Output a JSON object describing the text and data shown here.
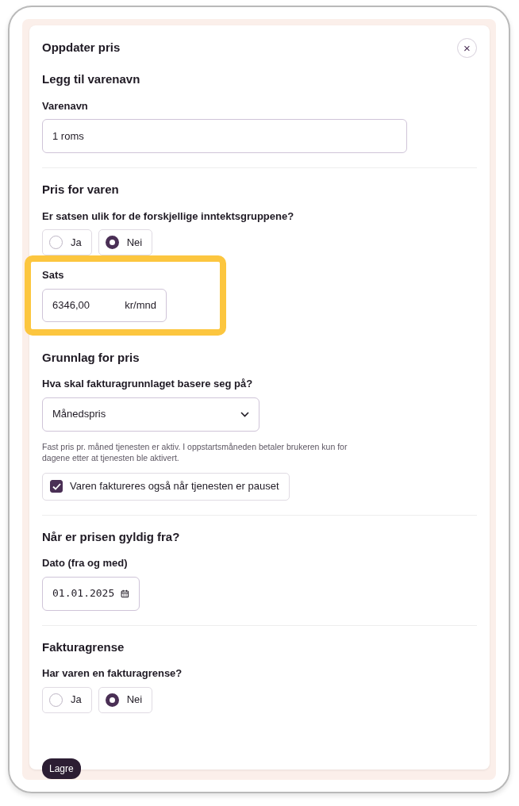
{
  "dialog": {
    "title": "Oppdater pris",
    "close_label": "×"
  },
  "sections": [
    {
      "heading": "Legg til varenavn",
      "divider": true,
      "fields": [
        {
          "kind": "text",
          "label": "Varenavn",
          "value": "1 roms"
        }
      ]
    },
    {
      "heading": "Pris for varen",
      "divider": false,
      "fields": [
        {
          "kind": "radio",
          "label": "Er satsen ulik for de forskjellige inntektsgruppene?",
          "options": [
            {
              "label": "Ja",
              "selected": false
            },
            {
              "label": "Nei",
              "selected": true
            }
          ]
        },
        {
          "kind": "amount",
          "label": "Sats",
          "value": "6346,00",
          "unit": "kr/mnd",
          "highlighted": true
        }
      ]
    },
    {
      "heading": "Grunnlag for pris",
      "divider": true,
      "fields": [
        {
          "kind": "select",
          "label": "Hva skal fakturagrunnlaget basere seg på?",
          "value": "Månedspris",
          "help": "Fast pris pr. måned tjenesten er aktiv. I oppstartsmåneden betaler brukeren kun for dagene etter at tjenesten ble aktivert."
        },
        {
          "kind": "checkbox",
          "label": "Varen faktureres også når tjenesten er pauset",
          "checked": true
        }
      ]
    },
    {
      "heading": "Når er prisen gyldig fra?",
      "divider": true,
      "fields": [
        {
          "kind": "date",
          "label": "Dato (fra og med)",
          "value": "01.01.2025"
        }
      ]
    },
    {
      "heading": "Fakturagrense",
      "divider": false,
      "fields": [
        {
          "kind": "radio",
          "label": "Har varen en fakturagrense?",
          "options": [
            {
              "label": "Ja",
              "selected": false
            },
            {
              "label": "Nei",
              "selected": true
            }
          ]
        }
      ]
    }
  ],
  "save_button": "Lagre"
}
